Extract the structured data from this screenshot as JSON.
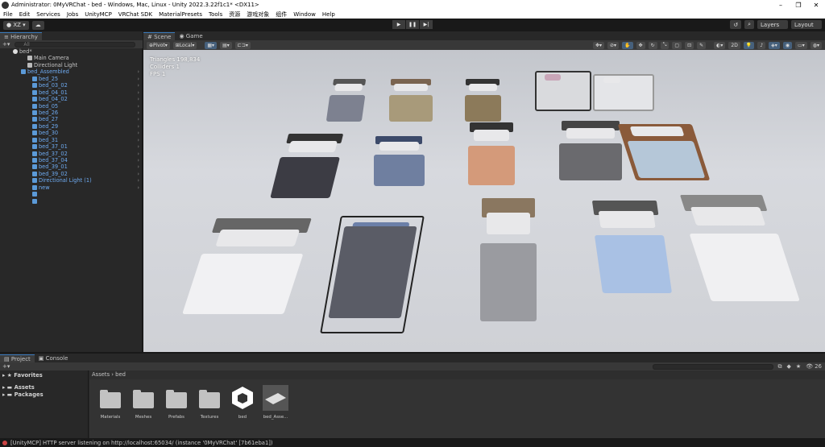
{
  "window": {
    "title": "Administrator: 0MyVRChat - bed - Windows, Mac, Linux - Unity 2022.3.22f1c1* <DX11>",
    "controls": [
      "–",
      "❐",
      "✕"
    ]
  },
  "menubar": [
    "File",
    "Edit",
    "Services",
    "Jobs",
    "UnityMCP",
    "VRChat SDK",
    "MaterialPresets",
    "Tools",
    "资源",
    "游戏对象",
    "组件",
    "Window",
    "Help"
  ],
  "toolbar": {
    "account": "XZ",
    "layers": "Layers",
    "layout": "Layout"
  },
  "hierarchy": {
    "tab": "Hierarchy",
    "search_placeholder": "All",
    "scene": "bed*",
    "items": [
      {
        "label": "Main Camera",
        "type": "normal",
        "depth": 2
      },
      {
        "label": "Directional Light",
        "type": "normal",
        "depth": 2
      },
      {
        "label": "bed_Assembled",
        "type": "prefab",
        "depth": 1
      },
      {
        "label": "bed_25",
        "type": "prefab",
        "depth": 3
      },
      {
        "label": "bed_03_02",
        "type": "prefab",
        "depth": 3
      },
      {
        "label": "bed_04_01",
        "type": "prefab",
        "depth": 3
      },
      {
        "label": "bed_04_02",
        "type": "prefab",
        "depth": 3
      },
      {
        "label": "bed_05",
        "type": "prefab",
        "depth": 3
      },
      {
        "label": "bed_26",
        "type": "prefab",
        "depth": 3
      },
      {
        "label": "bed_27",
        "type": "prefab",
        "depth": 3
      },
      {
        "label": "bed_29",
        "type": "prefab",
        "depth": 3
      },
      {
        "label": "bed_30",
        "type": "prefab",
        "depth": 3
      },
      {
        "label": "bed_31",
        "type": "prefab",
        "depth": 3
      },
      {
        "label": "bed_37_01",
        "type": "prefab",
        "depth": 3
      },
      {
        "label": "bed_37_02",
        "type": "prefab",
        "depth": 3
      },
      {
        "label": "bed_37_04",
        "type": "prefab",
        "depth": 3
      },
      {
        "label": "bed_39_01",
        "type": "prefab",
        "depth": 3
      },
      {
        "label": "bed_39_02",
        "type": "prefab",
        "depth": 3
      },
      {
        "label": "Directional Light (1)",
        "type": "prefab",
        "depth": 2
      },
      {
        "label": "new",
        "type": "prefab",
        "depth": 2
      }
    ]
  },
  "scene": {
    "tabs": [
      "Scene",
      "Game"
    ],
    "pivot": "Pivot",
    "local": "Local",
    "mode_2d": "2D",
    "stats": {
      "triangles": "Triangles 198,834",
      "colliders": "Colliders 1",
      "fps": "FPS 1"
    }
  },
  "project": {
    "tabs": [
      "Project",
      "Console"
    ],
    "sidebar": [
      "Favorites",
      "Assets",
      "Packages"
    ],
    "breadcrumb": "Assets › bed",
    "hidden_count": "26",
    "assets": [
      {
        "label": "Materials",
        "kind": "folder"
      },
      {
        "label": "Meshes",
        "kind": "folder"
      },
      {
        "label": "Prefabs",
        "kind": "folder"
      },
      {
        "label": "Textures",
        "kind": "folder"
      },
      {
        "label": "bed",
        "kind": "unity"
      },
      {
        "label": "bed_Asse...",
        "kind": "prefab"
      }
    ]
  },
  "status": {
    "message": "[UnityMCP] HTTP server listening on http://localhost:65034/  (instance '0MyVRChat' [7b61eba1])"
  },
  "colors": {
    "accent": "#3a79bb",
    "prefab_text": "#6eaaf0"
  }
}
